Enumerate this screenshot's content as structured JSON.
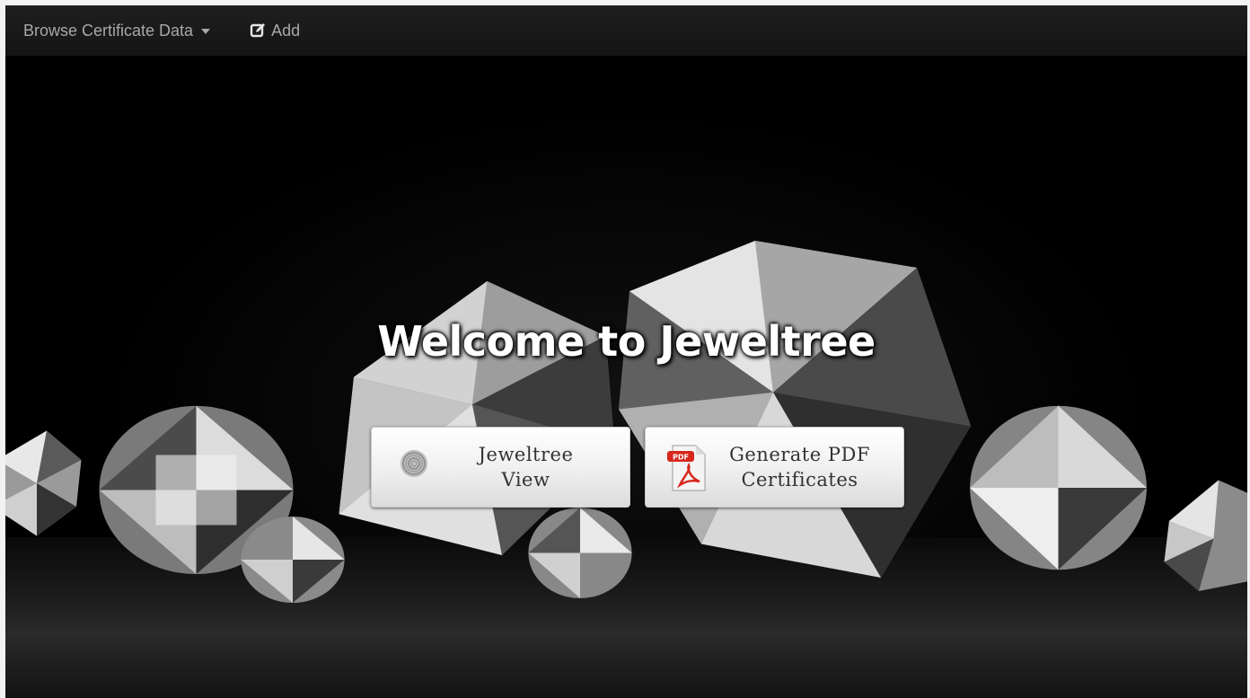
{
  "navbar": {
    "browse_label": "Browse Certificate Data",
    "add_label": "Add"
  },
  "hero": {
    "title": "Welcome to Jeweltree",
    "tiles": [
      {
        "line1": "Jeweltree",
        "line2": "View",
        "icon": "fingerprint-icon"
      },
      {
        "line1": "Generate PDF",
        "line2": "Certificates",
        "icon": "pdf-icon"
      }
    ]
  },
  "colors": {
    "navbar_bg": "#1a1a1a",
    "nav_text": "#a8a8a8",
    "hero_bg": "#000000",
    "tile_bg": "#f1f1f1",
    "tile_text": "#333333",
    "pdf_red": "#d8261c"
  }
}
